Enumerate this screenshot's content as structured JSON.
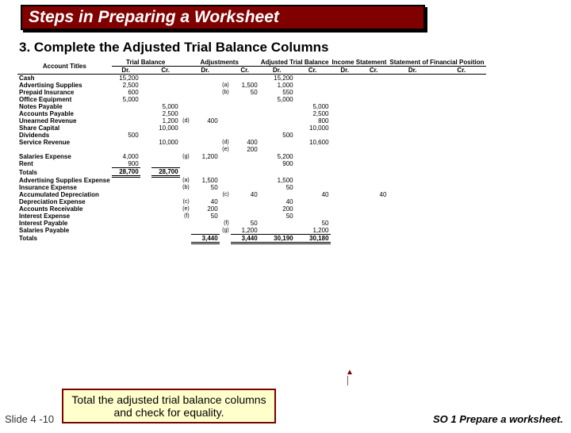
{
  "title": "Steps in Preparing a Worksheet",
  "subhead": "3. Complete the Adjusted Trial Balance Columns",
  "headers": {
    "acct": "Account Titles",
    "groups": [
      "Trial Balance",
      "Adjustments",
      "Adjusted Trial Balance",
      "Income Statement",
      "Statement of Financial Position"
    ],
    "dr": "Dr.",
    "cr": "Cr."
  },
  "rows": [
    {
      "t": "Cash",
      "tb_dr": "15,200",
      "atb_dr": "15,200"
    },
    {
      "t": "Advertising Supplies",
      "tb_dr": "2,500",
      "adj_cr": "1,500",
      "adj_cr_r": "(a)",
      "atb_dr": "1,000"
    },
    {
      "t": "Prepaid Insurance",
      "tb_dr": "600",
      "adj_cr": "50",
      "adj_cr_r": "(b)",
      "atb_dr": "550"
    },
    {
      "t": "Office Equipment",
      "tb_dr": "5,000",
      "atb_dr": "5,000"
    },
    {
      "t": "Notes Payable",
      "tb_cr": "5,000",
      "atb_cr": "5,000"
    },
    {
      "t": "Accounts Payable",
      "tb_cr": "2,500",
      "atb_cr": "2,500"
    },
    {
      "t": "Unearned Revenue",
      "tb_cr": "1,200",
      "adj_dr": "400",
      "adj_dr_r": "(d)",
      "atb_cr": "800"
    },
    {
      "t": "Share Capital",
      "tb_cr": "10,000",
      "atb_cr": "10,000"
    },
    {
      "t": "Dividends",
      "tb_dr": "500",
      "atb_dr": "500"
    },
    {
      "t": "Service Revenue",
      "tb_cr": "10,000",
      "adj_cr": "400",
      "adj_cr_r": "(d)",
      "atb_cr": "10,600"
    },
    {
      "t": "",
      "adj_cr": "200",
      "adj_cr_r": "(e)"
    },
    {
      "t": "Salaries Expense",
      "tb_dr": "4,000",
      "adj_dr": "1,200",
      "adj_dr_r": "(g)",
      "atb_dr": "5,200"
    },
    {
      "t": "Rent",
      "tb_dr": "900",
      "atb_dr": "900"
    },
    {
      "t": "Totals",
      "tot": 1,
      "tb_dr": "28,700",
      "tb_cr": "28,700",
      "dblTB": 1
    },
    {
      "t": "Advertising Supplies Expense",
      "adj_dr": "1,500",
      "adj_dr_r": "(a)",
      "atb_dr": "1,500"
    },
    {
      "t": "Insurance Expense",
      "adj_dr": "50",
      "adj_dr_r": "(b)",
      "atb_dr": "50"
    },
    {
      "t": "Accumulated Depreciation",
      "adj_cr": "40",
      "adj_cr_r": "(c)",
      "atb_cr": "40",
      "is_cr": "40"
    },
    {
      "t": "Depreciation Expense",
      "adj_dr": "40",
      "adj_dr_r": "(c)",
      "atb_dr": "40"
    },
    {
      "t": "Accounts Receivable",
      "adj_dr": "200",
      "adj_dr_r": "(e)",
      "atb_dr": "200"
    },
    {
      "t": "Interest Expense",
      "adj_dr": "50",
      "adj_dr_r": "(f)",
      "atb_dr": "50"
    },
    {
      "t": "Interest Payable",
      "adj_cr": "50",
      "adj_cr_r": "(f)",
      "atb_cr": "50"
    },
    {
      "t": "Salaries Payable",
      "adj_cr": "1,200",
      "adj_cr_r": "(g)",
      "atb_cr": "1,200"
    },
    {
      "t": "Totals",
      "tot": 1,
      "adj_dr": "3,440",
      "adj_cr": "3,440",
      "atb_dr": "30,190",
      "atb_cr": "30,180",
      "dblADJ": 1,
      "dblATB": 1
    }
  ],
  "note": "Total the adjusted trial balance columns and check for equality.",
  "slide": "Slide 4 -10",
  "so": "SO 1  Prepare a worksheet."
}
